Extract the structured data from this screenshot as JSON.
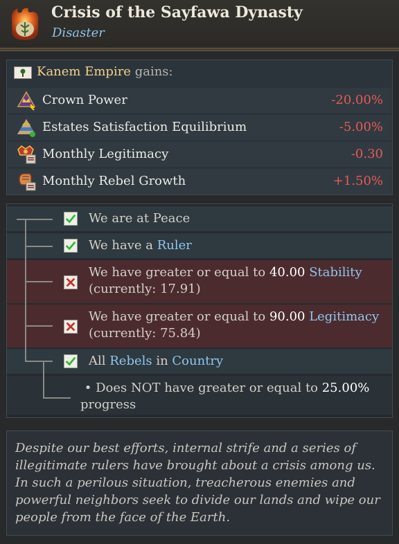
{
  "header": {
    "title": "Crisis of the Sayfawa Dynasty",
    "subtitle": "Disaster",
    "icon": "disaster-icon"
  },
  "gains": {
    "country": "Kanem Empire",
    "suffix": " gains:",
    "flag_icon": "flag-icon"
  },
  "modifiers": [
    {
      "label": "Crown Power",
      "value": "-20.00%",
      "icon": "crown-power-icon"
    },
    {
      "label": "Estates Satisfaction Equilibrium",
      "value": "-5.00%",
      "icon": "estates-icon"
    },
    {
      "label": "Monthly Legitimacy",
      "value": "-0.30",
      "icon": "legitimacy-icon"
    },
    {
      "label": "Monthly Rebel Growth",
      "value": "+1.50%",
      "icon": "rebel-icon"
    }
  ],
  "triggers": {
    "peace": {
      "text": "We are at Peace",
      "met": true
    },
    "ruler": {
      "prefix": "We have a ",
      "link": "Ruler",
      "met": true
    },
    "stability": {
      "prefix": "We have greater or equal to ",
      "value": "40.00",
      "link": "Stability",
      "current": "(currently: 17.91)",
      "met": false
    },
    "legitimacy": {
      "prefix": "We have greater or equal to ",
      "value": "90.00",
      "link": "Legitimacy",
      "current": "(currently: 75.84)",
      "met": false
    },
    "rebels": {
      "prefix": "All ",
      "link1": "Rebels",
      "middle": " in ",
      "link2": "Country",
      "met": true
    },
    "progress": {
      "bullet": "•",
      "prefix": "Does NOT have greater or equal to ",
      "value": "25.00%",
      "suffix": "progress"
    }
  },
  "description": "Despite our best efforts, internal strife and a series of illegitimate rulers have brought about a crisis among us. In such a perilous situation, treacherous enemies and powerful neighbors seek to divide our lands and wipe our people from the face of the Earth.",
  "colors": {
    "negative": "#e65a55",
    "link": "#8fc7ea",
    "country": "#f2d28a",
    "check": "#3bb33b",
    "cross": "#d02a2a"
  }
}
